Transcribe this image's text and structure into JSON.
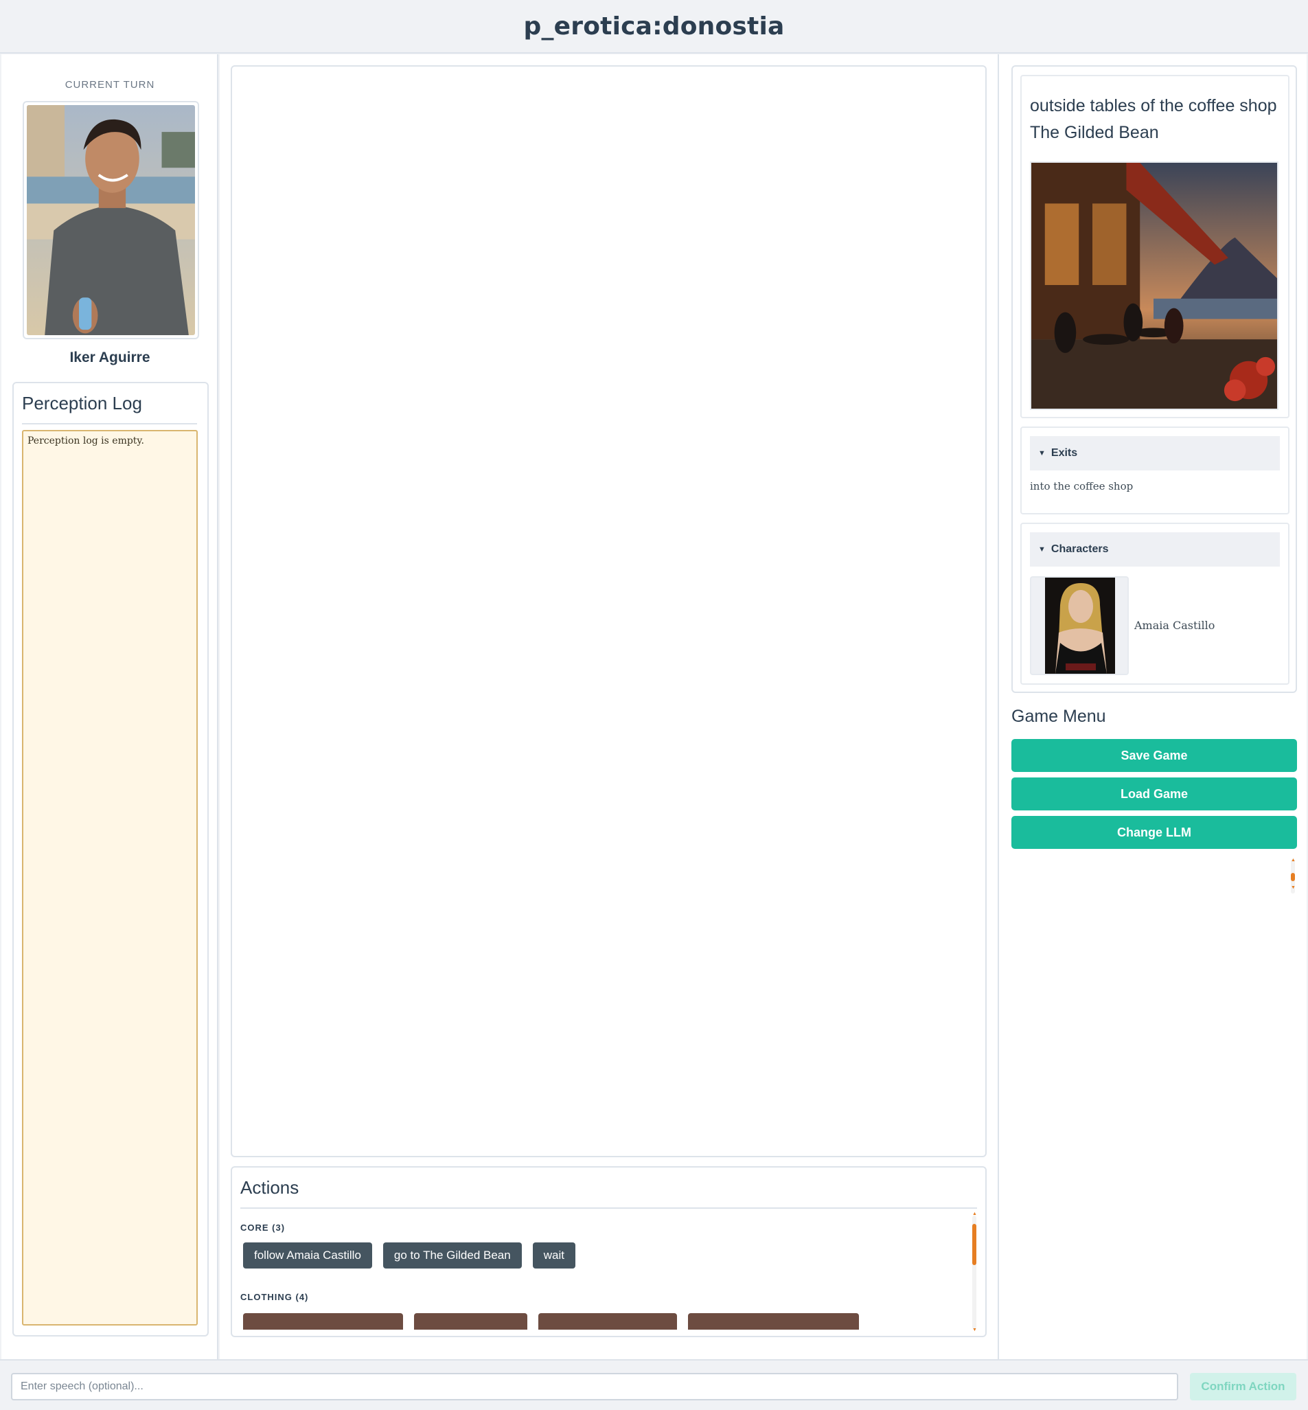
{
  "app": {
    "title": "p_erotica:donostia"
  },
  "left": {
    "current_turn_label": "CURRENT TURN",
    "player_name": "Iker Aguirre",
    "perception": {
      "title": "Perception Log",
      "empty_text": "Perception log is empty."
    }
  },
  "actions": {
    "title": "Actions",
    "categories": [
      {
        "label": "CORE (3)",
        "buttons": [
          "follow Amaia Castillo",
          "go to The Gilded Bean",
          "wait"
        ]
      },
      {
        "label": "CLOTHING (4)",
        "buttons": [
          "",
          "",
          "",
          ""
        ]
      }
    ]
  },
  "location": {
    "name": "outside tables of the coffee shop The Gilded Bean",
    "exits_header": "Exits",
    "exits": [
      "into the coffee shop"
    ],
    "characters_header": "Characters",
    "characters": [
      "Amaia Castillo"
    ]
  },
  "game_menu": {
    "title": "Game Menu",
    "save": "Save Game",
    "load": "Load Game",
    "change_llm": "Change LLM"
  },
  "input": {
    "speech_placeholder": "Enter speech (optional)...",
    "confirm": "Confirm Action"
  },
  "colors": {
    "accent": "#1abc9c",
    "core_button": "#455560",
    "clothing_button": "#6d4c41",
    "scroll_accent": "#e67e22",
    "log_background": "#fff7e6"
  }
}
